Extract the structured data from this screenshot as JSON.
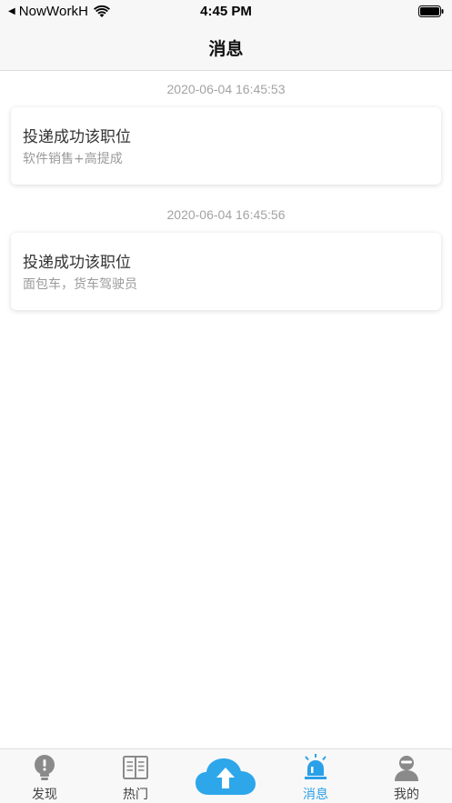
{
  "status_bar": {
    "back_caret": "◀",
    "carrier": "NowWorkH",
    "time": "4:45 PM"
  },
  "nav": {
    "title": "消息"
  },
  "messages": [
    {
      "time": "2020-06-04 16:45:53",
      "title": "投递成功该职位",
      "subtitle": "软件销售+高提成"
    },
    {
      "time": "2020-06-04 16:45:56",
      "title": "投递成功该职位",
      "subtitle": "面包车，货车驾驶员"
    }
  ],
  "tab_bar": {
    "tabs": [
      {
        "label": "发现",
        "icon": "lightbulb-icon"
      },
      {
        "label": "热门",
        "icon": "book-icon"
      },
      {
        "label": "",
        "icon": "cloud-upload-icon"
      },
      {
        "label": "消息",
        "icon": "siren-icon",
        "active": true
      },
      {
        "label": "我的",
        "icon": "person-icon"
      }
    ],
    "active_color": "#2aa0e8",
    "inactive_color": "#8a8a8a"
  }
}
